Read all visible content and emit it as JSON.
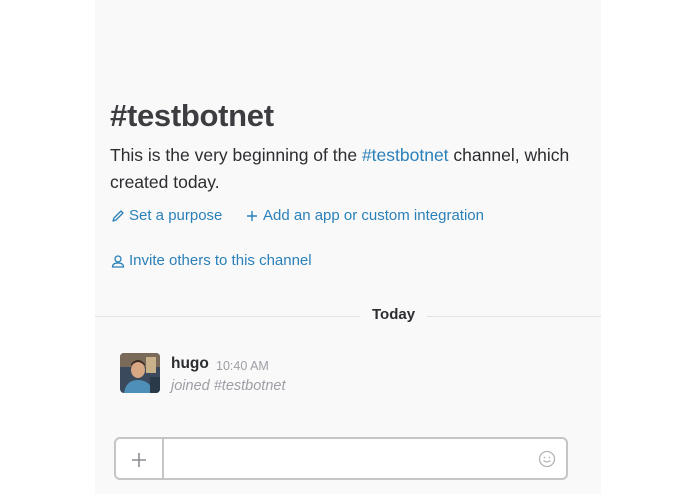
{
  "channel": {
    "title": "#testbotnet",
    "intro_before": "This is the very beginning of the ",
    "intro_link": "#testbotnet",
    "intro_after": " channel, which",
    "intro_line2": "created today."
  },
  "actions": {
    "purpose_label": "Set a purpose",
    "add_app_label": "Add an app or custom integration",
    "invite_label": "Invite others to this channel"
  },
  "divider": {
    "label": "Today"
  },
  "message": {
    "author": "hugo",
    "time": "10:40 AM",
    "text": "joined #testbotnet"
  },
  "composer": {
    "value": "",
    "placeholder": ""
  },
  "colors": {
    "link": "#2a80b9",
    "panel_bg": "#f9f9f9",
    "text": "#2c2d30",
    "muted": "#9e9ea6"
  },
  "icons": {
    "purpose": "pencil-icon",
    "add_app": "plus-icon",
    "invite": "person-icon",
    "composer_plus": "plus-icon",
    "composer_emoji": "smiley-icon"
  }
}
